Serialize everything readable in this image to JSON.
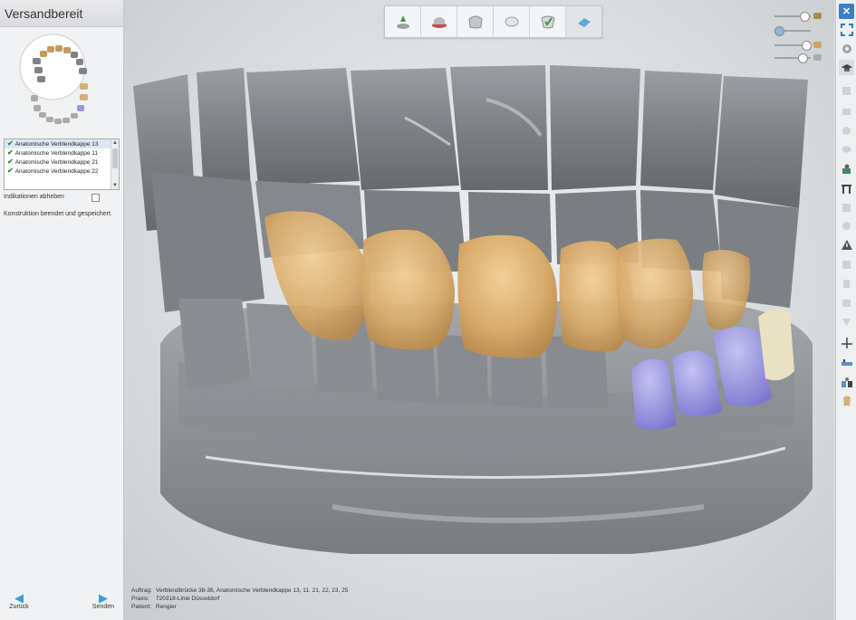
{
  "panel": {
    "title": "Versandbereit",
    "indications": [
      "Anatomische Verblendkappe 13",
      "Anatomische Verblendkappe 11",
      "Anatomische Verblendkappe 21",
      "Anatomische Verblendkappe 22"
    ],
    "checkbox_label": "Indikationen abheben",
    "status": "Konstruktion beendet und gespeichert.",
    "back_label": "Zurück",
    "send_label": "Senden"
  },
  "workflow_steps": [
    "scan-icon",
    "preparation-icon",
    "model-icon",
    "crown-icon",
    "design-icon",
    "send-icon"
  ],
  "right_tools": [
    "close-icon",
    "fit-view-icon",
    "rotate-icon",
    "cap-icon",
    "tool-1-icon",
    "tool-2-icon",
    "tool-3-icon",
    "tool-4-icon",
    "tool-5-icon",
    "tool-6-icon",
    "tool-7-icon",
    "tool-8-icon",
    "warning-icon",
    "tool-9-icon",
    "tool-10-icon",
    "tool-11-icon",
    "tool-12-icon",
    "cross-section-icon",
    "ruler-icon",
    "compare-icon",
    "tooth-icon"
  ],
  "info": {
    "order_key": "Auftrag:",
    "order_value": "Verblendbrücke 38-36, Anatomische Verblendkappe 13, 11, 21, 22, 23, 25",
    "practice_key": "Praxis:",
    "practice_value": "720318-Linie Düsseldorf",
    "patient_key": "Patient:",
    "patient_value": "Rengier"
  },
  "colors": {
    "tooth_gray": "#8e9195",
    "veneer_gold": "#d9ac6c",
    "prep_blue": "#8c88d8",
    "accent_blue": "#3b9fd8"
  }
}
